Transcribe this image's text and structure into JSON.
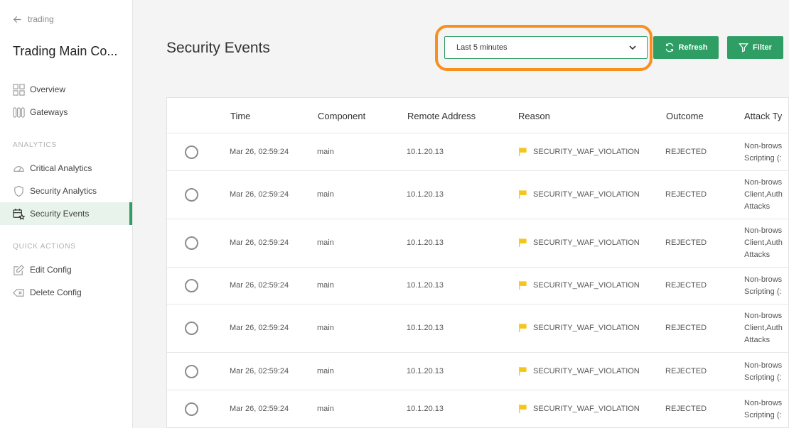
{
  "sidebar": {
    "back_label": "trading",
    "title": "Trading Main Co...",
    "nav": [
      {
        "label": "Overview",
        "icon": "grid-icon"
      },
      {
        "label": "Gateways",
        "icon": "gateways-icon"
      }
    ],
    "analytics_label": "ANALYTICS",
    "analytics": [
      {
        "label": "Critical Analytics",
        "icon": "gauge-icon"
      },
      {
        "label": "Security Analytics",
        "icon": "shield-icon"
      },
      {
        "label": "Security Events",
        "icon": "calendar-star-icon",
        "active": true
      }
    ],
    "quick_label": "QUICK ACTIONS",
    "quick": [
      {
        "label": "Edit Config",
        "icon": "edit-icon"
      },
      {
        "label": "Delete Config",
        "icon": "delete-icon"
      }
    ]
  },
  "header": {
    "title": "Security Events",
    "time_range": "Last 5 minutes",
    "refresh_label": "Refresh",
    "filter_label": "Filter"
  },
  "colors": {
    "accent": "#2e9e64",
    "highlight": "#f7901e",
    "flag": "#f5c518"
  },
  "table": {
    "columns": [
      "Time",
      "Component",
      "Remote Address",
      "Reason",
      "Outcome",
      "Attack Ty"
    ],
    "rows": [
      {
        "time": "Mar 26, 02:59:24",
        "component": "main",
        "address": "10.1.20.13",
        "reason": "SECURITY_WAF_VIOLATION",
        "outcome": "REJECTED",
        "attack": [
          "Non-brows",
          "Scripting (:"
        ]
      },
      {
        "time": "Mar 26, 02:59:24",
        "component": "main",
        "address": "10.1.20.13",
        "reason": "SECURITY_WAF_VIOLATION",
        "outcome": "REJECTED",
        "attack": [
          "Non-brows",
          "Client,Auth",
          "Attacks"
        ]
      },
      {
        "time": "Mar 26, 02:59:24",
        "component": "main",
        "address": "10.1.20.13",
        "reason": "SECURITY_WAF_VIOLATION",
        "outcome": "REJECTED",
        "attack": [
          "Non-brows",
          "Client,Auth",
          "Attacks"
        ]
      },
      {
        "time": "Mar 26, 02:59:24",
        "component": "main",
        "address": "10.1.20.13",
        "reason": "SECURITY_WAF_VIOLATION",
        "outcome": "REJECTED",
        "attack": [
          "Non-brows",
          "Scripting (:"
        ]
      },
      {
        "time": "Mar 26, 02:59:24",
        "component": "main",
        "address": "10.1.20.13",
        "reason": "SECURITY_WAF_VIOLATION",
        "outcome": "REJECTED",
        "attack": [
          "Non-brows",
          "Client,Auth",
          "Attacks"
        ]
      },
      {
        "time": "Mar 26, 02:59:24",
        "component": "main",
        "address": "10.1.20.13",
        "reason": "SECURITY_WAF_VIOLATION",
        "outcome": "REJECTED",
        "attack": [
          "Non-brows",
          "Scripting (:"
        ]
      },
      {
        "time": "Mar 26, 02:59:24",
        "component": "main",
        "address": "10.1.20.13",
        "reason": "SECURITY_WAF_VIOLATION",
        "outcome": "REJECTED",
        "attack": [
          "Non-brows",
          "Scripting (:"
        ]
      }
    ]
  }
}
